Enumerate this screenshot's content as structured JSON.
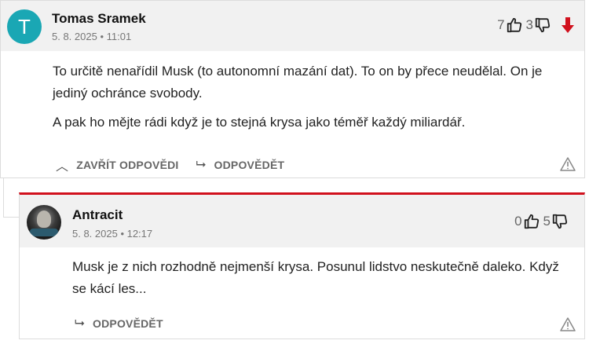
{
  "comments": [
    {
      "avatar_letter": "T",
      "author": "Tomas Sramek",
      "date": "5. 8. 2025 • 11:01",
      "likes": "7",
      "dislikes": "3",
      "paragraphs": [
        "To určitě nenařídil Musk (to autonomní mazání dat). To on by přece neudělal. On je jediný ochránce svobody.",
        "A pak ho mějte rádi když je to stejná krysa jako téměř každý miliardář."
      ],
      "actions": [
        "ZAVŘÍT ODPOVĚDI",
        "ODPOVĚDĚT"
      ]
    },
    {
      "author": "Antracit",
      "date": "5. 8. 2025 • 12:17",
      "likes": "0",
      "dislikes": "5",
      "paragraphs": [
        "Musk je z nich rozhodně nejmenší krysa. Posunul lidstvo neskutečně daleko. Když se kácí les..."
      ],
      "actions": [
        "ODPOVĚDĚT"
      ]
    }
  ],
  "colors": {
    "accent": "#d1111d",
    "avatar_bg": "#1aa7b4",
    "header_bg": "#f1f1f1"
  }
}
